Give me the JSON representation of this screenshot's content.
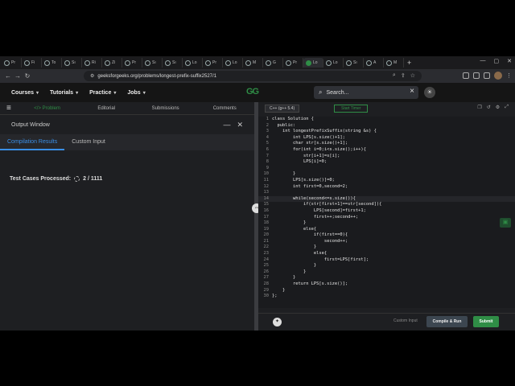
{
  "browser": {
    "tabs": [
      {
        "label": "Pr",
        "active": false
      },
      {
        "label": "Fi",
        "active": false
      },
      {
        "label": "To",
        "active": false
      },
      {
        "label": "Sı",
        "active": false
      },
      {
        "label": "Ri",
        "active": false
      },
      {
        "label": "Zi",
        "active": false
      },
      {
        "label": "Pr",
        "active": false
      },
      {
        "label": "Sı",
        "active": false
      },
      {
        "label": "Sı",
        "active": false
      },
      {
        "label": "Lo",
        "active": false
      },
      {
        "label": "Pr",
        "active": false
      },
      {
        "label": "Lo",
        "active": false
      },
      {
        "label": "M",
        "active": false
      },
      {
        "label": "G",
        "active": false
      },
      {
        "label": "Pr",
        "active": false
      },
      {
        "label": "Lo",
        "active": true
      },
      {
        "label": "Lo",
        "active": false
      },
      {
        "label": "Sı",
        "active": false
      },
      {
        "label": "A",
        "active": false
      },
      {
        "label": "M",
        "active": false
      }
    ],
    "new_tab": "+",
    "url": "geeksforgeeks.org/problems/longest-prefix-suffix2527/1"
  },
  "header": {
    "menus": [
      "Courses",
      "Tutorials",
      "Practice",
      "Jobs"
    ],
    "logo": "GG",
    "search_placeholder": "Search..."
  },
  "left": {
    "tabs": [
      "</> Problem",
      "Editorial",
      "Submissions",
      "Comments"
    ],
    "output_title": "Output Window",
    "subtabs": [
      "Compilation Results",
      "Custom Input"
    ],
    "test_cases_label": "Test Cases Processed:",
    "test_cases_value": "2 / 1111"
  },
  "editor": {
    "language": "C++ (g++ 5.4)",
    "timer": "Start Timer",
    "lines": [
      "class Solution {",
      "  public:",
      "    int longestPrefixSuffix(string &s) {",
      "        int LPS[s.size()+1];",
      "        char str[s.size()+1];",
      "        for(int i=0;i<s.size();i++){",
      "            str[i+1]=s[i];",
      "            LPS[i]=0;",
      "",
      "        }",
      "        LPS[s.size()]=0;",
      "        int first=0,second=2;",
      "",
      "        while(second<=s.size()){",
      "            if(str[first+1]==str[second]){",
      "                LPS[second]=first+1;",
      "                first++;second++;",
      "            }",
      "            else{",
      "                if(first==0){",
      "                    second++;",
      "                }",
      "                else{",
      "                    first=LPS[first];",
      "                }",
      "            }",
      "        }",
      "        return LPS[s.size()];",
      "    }",
      "};"
    ],
    "highlight_line": 14,
    "custom_input": "Custom Input",
    "compile_label": "Compile & Run",
    "submit_label": "Submit"
  }
}
